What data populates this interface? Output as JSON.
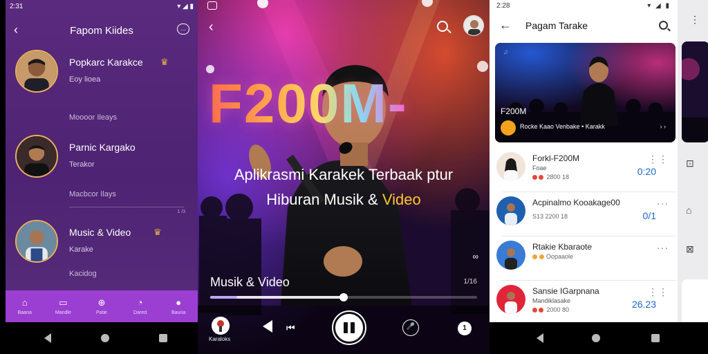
{
  "panel_left": {
    "status_time": "2:31",
    "status_icons": "▾ ◢ ▮",
    "title": "Fapom Kiides",
    "items": [
      {
        "name": "Popkarc Karakce",
        "sub": "Eoy lioea",
        "meta": "Moooor Ileays",
        "crown": true
      },
      {
        "name": "Parnic Kargako",
        "sub": "Terakor",
        "meta": "Macbcor Ilays",
        "crown": false
      },
      {
        "name": "Music & Video",
        "sub": "Karake",
        "meta": "Kacidog",
        "crown": true
      }
    ],
    "divider_num": "1 /3",
    "nav": [
      {
        "label": "Baana",
        "icon": "home-icon",
        "glyph": "⌂"
      },
      {
        "label": "Mandle",
        "icon": "library-icon",
        "glyph": "▭"
      },
      {
        "label": "Patie",
        "icon": "search-icon",
        "glyph": "⊕"
      },
      {
        "label": "Dared",
        "icon": "clock-icon",
        "glyph": "◔"
      },
      {
        "label": "Bauna",
        "icon": "profile-icon",
        "glyph": "●"
      }
    ]
  },
  "panel_player": {
    "big_title": "F200M-",
    "tagline_1": "Aplikrasmi Karakek Terbaak ptur",
    "tagline_2a": "Hiburan Musik & ",
    "tagline_2b": "Video",
    "now_playing": "Musik & Video",
    "count": "1/16",
    "progress": 0.5,
    "karaoke_label": "Karaloks",
    "queue_count": "1"
  },
  "panel_list": {
    "status_time": "2:28",
    "status_icons": "▾ ◢ ▮",
    "title": "Pagam Tarake",
    "hero": {
      "title": "F200M",
      "subtitle": "Rocke Kaao Venbake • Karakk",
      "more": "› ›"
    },
    "rows": [
      {
        "title": "Forkl-F200M",
        "sub": "Foae",
        "meta": "2800 18",
        "time": "0:20",
        "menu": "⋮⋮"
      },
      {
        "title": "Acpinalmo Kooakage00",
        "sub": "",
        "meta": "S13  2200 18",
        "time": "0/1",
        "menu": "···"
      },
      {
        "title": "Rtakie Kbaraote",
        "sub": "",
        "meta": "Oopaaole",
        "time": "",
        "menu": "···"
      },
      {
        "title": "Sansie IGarpnana",
        "sub": "Mandiklasake",
        "meta": "2000 80",
        "time": "26.23",
        "menu": "⋮⋮"
      }
    ]
  },
  "colors": {
    "purple_bg": "#4e2373",
    "nav_purple": "#9b3fd3",
    "accent_gold": "#e6b54a",
    "time_blue": "#1e64c8"
  }
}
